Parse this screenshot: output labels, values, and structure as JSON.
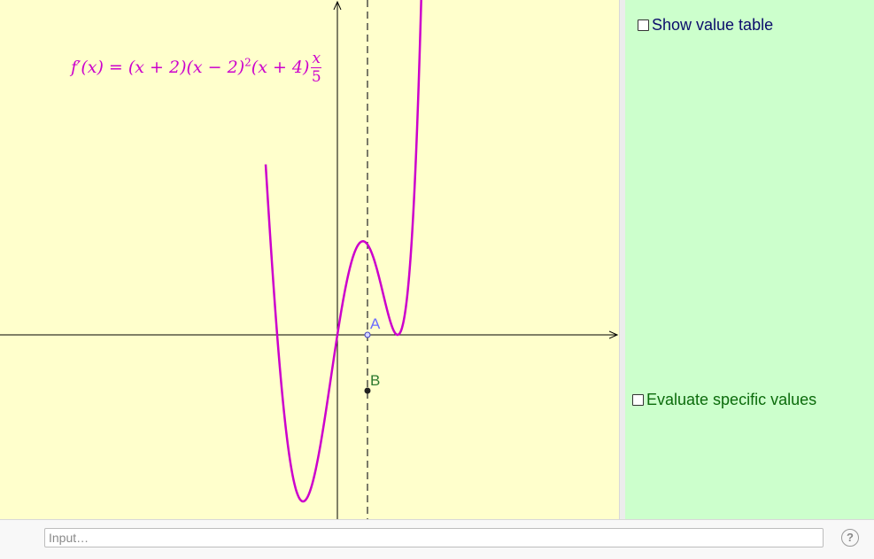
{
  "graphics": {
    "formula": {
      "lhs": "f′(x) = (x + 2)(x − 2)",
      "exp": "2",
      "rest": "(x + 4)",
      "frac_num": "x",
      "frac_den": "5"
    },
    "points": [
      {
        "name": "A",
        "color": "#6b6bff"
      },
      {
        "name": "B",
        "color": "#2d7a2d"
      }
    ],
    "curve_color": "#cc00cc",
    "background": "#ffffcc"
  },
  "side_panel": {
    "background": "#ccffcc",
    "show_value_table": {
      "label": "Show value table",
      "checked": false
    },
    "evaluate_specific_values": {
      "label": "Evaluate specific values",
      "checked": false
    }
  },
  "input_bar": {
    "placeholder": "Input…",
    "help_icon": "question-circle-icon",
    "help_glyph": "?"
  }
}
